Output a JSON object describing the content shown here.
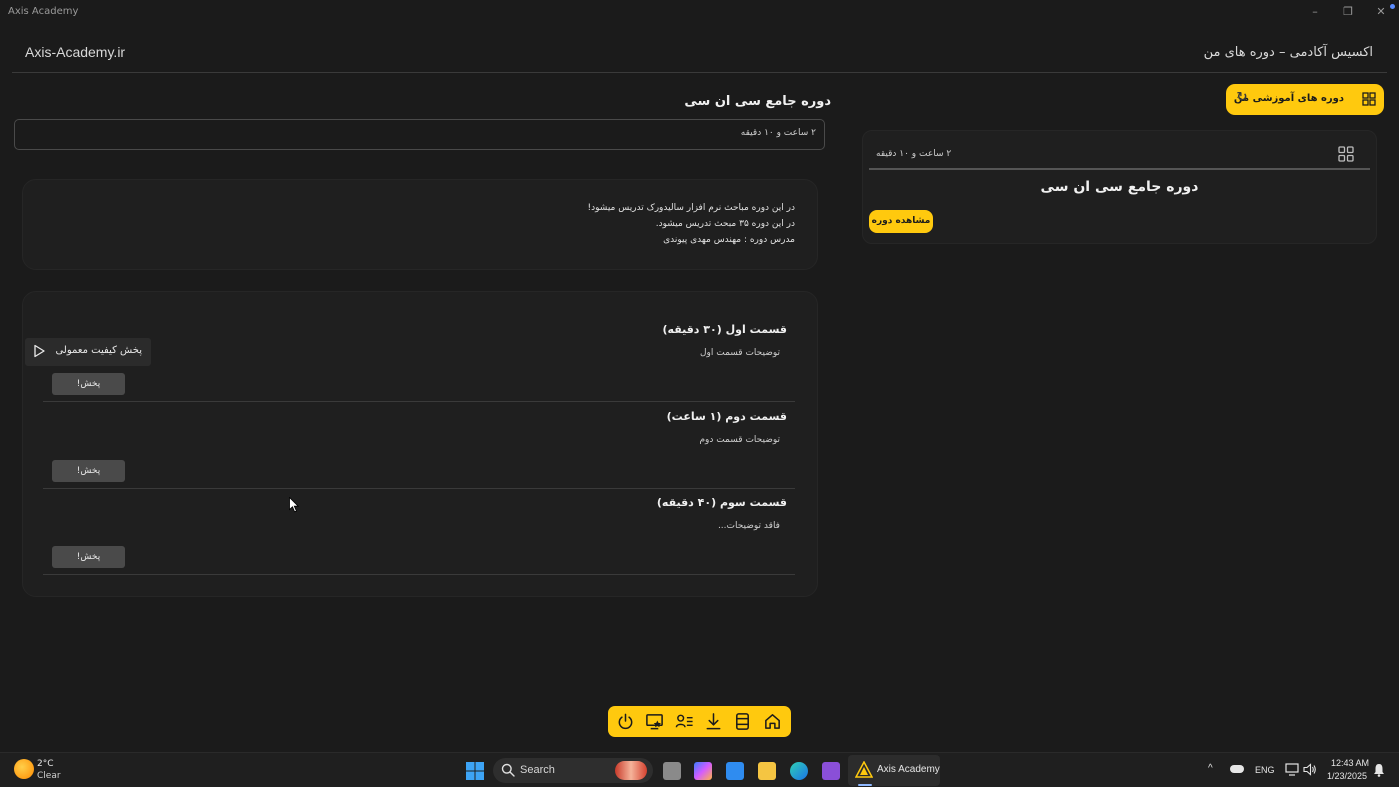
{
  "window": {
    "title": "Axis Academy",
    "minimize": "–",
    "maximize": "❐",
    "close": "✕"
  },
  "header": {
    "brand_left": "Axis-Academy.ir",
    "brand_right": "اکسیس آکادمی – دوره های من"
  },
  "sidebar": {
    "my_courses_label": "دوره های آموزشی من",
    "refresh_icon": "↻",
    "course_card": {
      "duration": "۲ ساعت و ۱۰ دقیقه",
      "title": "دوره جامع سی ان سی",
      "view_button": "مشاهده دوره"
    }
  },
  "main": {
    "course_title": "دوره جامع سی ان سی",
    "duration": "۲ ساعت و ۱۰ دقیقه",
    "description_lines": [
      "در این دوره مباحث نرم افزار سالیدورک تدریس میشود!",
      "در این دوره ۳۵ مبحث تدریس میشود.",
      "مدرس دوره : مهندس مهدی پیوندی"
    ],
    "episodes": [
      {
        "title": "قسمت اول (۳۰ دقیقه)",
        "desc": "توضیحات قسمت اول",
        "play": "پخش!"
      },
      {
        "title": "قسمت دوم (۱ ساعت)",
        "desc": "توضیحات قسمت دوم",
        "play": "پخش!"
      },
      {
        "title": "قسمت سوم (۴۰ دقیقه)",
        "desc": "فاقد توضیحات...",
        "play": "پخش!"
      }
    ],
    "tooltip": "پخش کیفیت معمولی"
  },
  "toolbar": {
    "icons": [
      "power-icon",
      "screen-star-icon",
      "user-list-icon",
      "download-icon",
      "bookmark-icon",
      "home-icon"
    ]
  },
  "taskbar": {
    "weather_temp": "2°C",
    "weather_desc": "Clear",
    "search_label": "Search",
    "active_app": "Axis Academy",
    "language": "ENG",
    "time": "12:43 AM",
    "date": "1/23/2025",
    "chevron": "^"
  },
  "colors": {
    "accent": "#ffc90e",
    "background": "#1b1b1b",
    "card": "#1f1f1f"
  }
}
